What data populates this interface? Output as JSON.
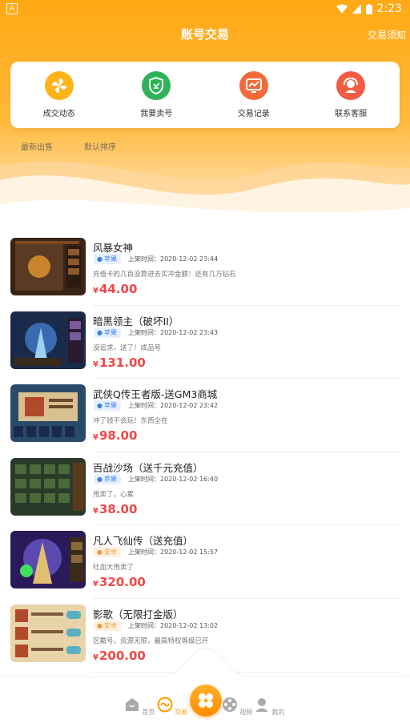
{
  "status_bar": {
    "time": "2:23",
    "left_icon": "A"
  },
  "header": {
    "title": "账号交易",
    "notice": "交易须知"
  },
  "quick_actions": [
    {
      "label": "成交动态",
      "icon": "pinwheel-icon",
      "color": "#FFB31A"
    },
    {
      "label": "我要卖号",
      "icon": "shield-sell-icon",
      "color": "#2EB25A"
    },
    {
      "label": "交易记录",
      "icon": "chart-monitor-icon",
      "color": "#F26A3A"
    },
    {
      "label": "联系客服",
      "icon": "customer-service-icon",
      "color": "#F25C45"
    }
  ],
  "sort": {
    "latest": "最新出售",
    "default": "默认排序"
  },
  "items": [
    {
      "name": "风暴女神",
      "platform": "苹果",
      "time": "上架时间：2020-12-02 23:44",
      "desc": "充值卡的几百没算进去实冲金额！还有几万钻石",
      "currency": "¥",
      "price": "44.00"
    },
    {
      "name": "暗黑领主（破坏II）",
      "platform": "苹果",
      "time": "上架时间：2020-12-02 23:43",
      "desc": "没追求，送了！成品号",
      "currency": "¥",
      "price": "131.00"
    },
    {
      "name": "武侠Q传王者版-送GM3商城",
      "platform": "苹果",
      "time": "上架时间：2020-12-02 23:42",
      "desc": "冲了钱不会玩！东西全在",
      "currency": "¥",
      "price": "98.00"
    },
    {
      "name": "百战沙场（送千元充值）",
      "platform": "苹果",
      "time": "上架时间：2020-12-02 16:40",
      "desc": "甩卖了，心累",
      "currency": "¥",
      "price": "38.00"
    },
    {
      "name": "凡人飞仙传（送充值）",
      "platform": "安卓",
      "time": "上架时间：2020-12-02 15:57",
      "desc": "吐血大甩卖了",
      "currency": "¥",
      "price": "320.00"
    },
    {
      "name": "影歌（无限打金版）",
      "platform": "安卓",
      "time": "上架时间：2020-12-02 13:02",
      "desc": "区霸号，资源无限，最高特权等级已开",
      "currency": "¥",
      "price": "200.00"
    }
  ],
  "tabs": [
    {
      "label": "首页",
      "icon": "home-icon",
      "active": false
    },
    {
      "label": "交易",
      "icon": "trade-icon",
      "active": true
    },
    {
      "label": "",
      "icon": "center-grid-icon",
      "active": false
    },
    {
      "label": "视频",
      "icon": "film-reel-icon",
      "active": false
    },
    {
      "label": "我的",
      "icon": "user-icon",
      "active": false
    }
  ],
  "colors": {
    "accent": "#FFA914",
    "price": "#F04848",
    "active_tab": "#FF9A00"
  }
}
